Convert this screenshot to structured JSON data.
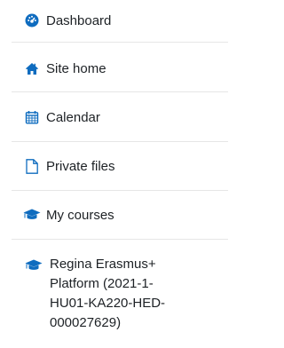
{
  "nav": {
    "items": [
      {
        "label": "Dashboard",
        "icon": "dashboard-icon"
      },
      {
        "label": "Site home",
        "icon": "home-icon"
      },
      {
        "label": "Calendar",
        "icon": "calendar-icon"
      },
      {
        "label": "Private files",
        "icon": "file-icon"
      },
      {
        "label": "My courses",
        "icon": "graduation-cap-icon"
      }
    ],
    "course": {
      "label": "Regina Erasmus+ Platform (2021-1-HU01-KA220-HED-000027629)",
      "icon": "graduation-cap-icon"
    }
  },
  "colors": {
    "icon_blue": "#0f6cbf",
    "text": "#1d2125",
    "divider": "#e6e6e6"
  }
}
